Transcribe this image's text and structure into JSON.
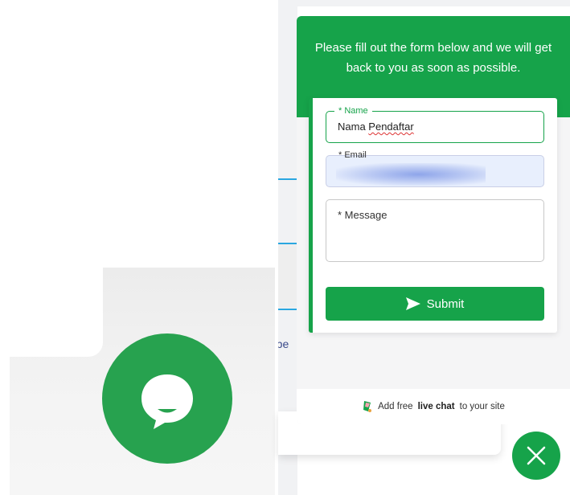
{
  "colors": {
    "brand_green": "#16a34a",
    "launcher_green": "#27a24f",
    "link_blue": "#2aa7e0"
  },
  "background_page": {
    "partial_text": "mbe"
  },
  "launcher": {
    "icon": "speech-bubble-smile-icon"
  },
  "widget": {
    "header_text": "Please fill out the form below and we will get back to you as soon as possible.",
    "form": {
      "name": {
        "label": "* Name",
        "value_prefix": "Nama ",
        "value_underlined": "Pendaftar"
      },
      "email": {
        "label": "* Email",
        "value": ""
      },
      "message": {
        "label": "* Message",
        "value": ""
      },
      "submit": {
        "label": "Submit",
        "icon": "paper-plane-icon"
      }
    },
    "footer": {
      "icon": "livechat-logo-icon",
      "prefix": "Add free",
      "bold": "live chat",
      "suffix": "to your site"
    },
    "close": {
      "icon": "close-icon"
    }
  }
}
